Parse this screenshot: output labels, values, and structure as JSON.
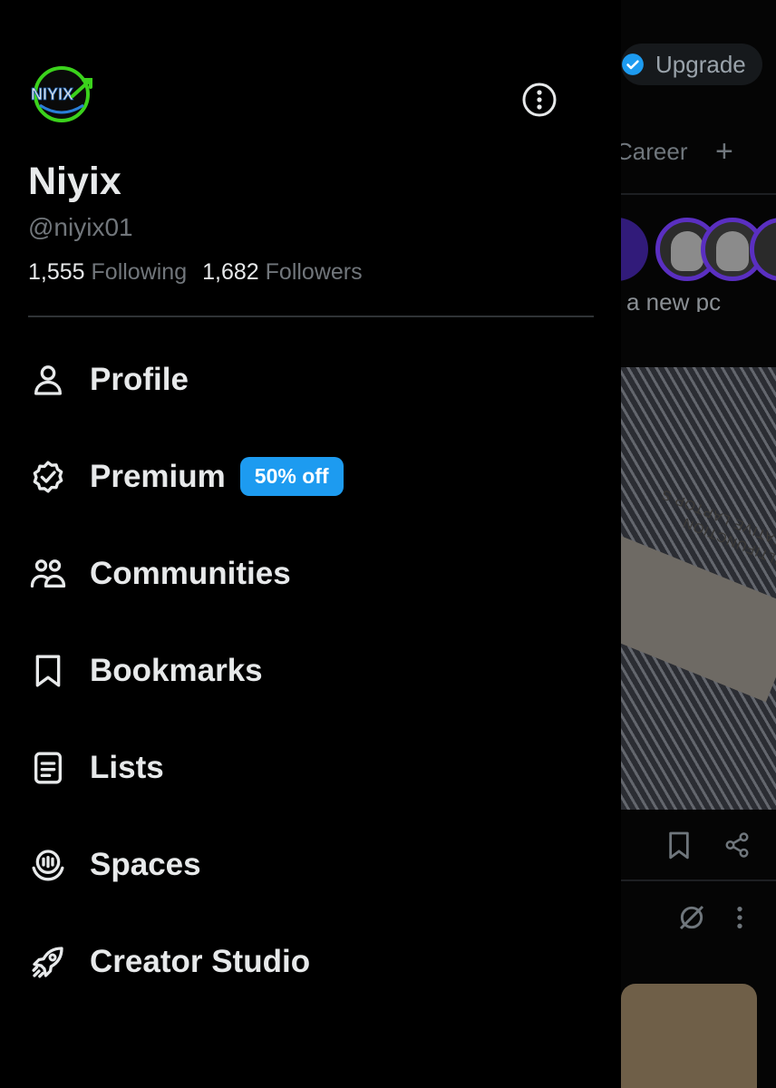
{
  "feed": {
    "upgrade_label": "Upgrade",
    "tab_partial": "Career",
    "add_tab_symbol": "+",
    "post_clip_text": "a new pc",
    "photo_text": "MULTIFUNCTION CREATIVE LAPTOP S"
  },
  "profile": {
    "logo_text": "NIYIX",
    "name": "Niyix",
    "handle": "@niyix01",
    "following_count": "1,555",
    "following_label": "Following",
    "followers_count": "1,682",
    "followers_label": "Followers"
  },
  "menu": {
    "items": [
      {
        "label": "Profile",
        "icon": "person-icon"
      },
      {
        "label": "Premium",
        "icon": "verified-badge-icon",
        "badge": "50% off"
      },
      {
        "label": "Communities",
        "icon": "communities-icon"
      },
      {
        "label": "Bookmarks",
        "icon": "bookmark-icon"
      },
      {
        "label": "Lists",
        "icon": "list-icon"
      },
      {
        "label": "Spaces",
        "icon": "spaces-icon"
      },
      {
        "label": "Creator Studio",
        "icon": "rocket-icon"
      }
    ]
  },
  "colors": {
    "background": "#000000",
    "text": "#e7e9ea",
    "muted": "#71767b",
    "accent": "#1d9bf0",
    "divider": "#2f3336"
  }
}
